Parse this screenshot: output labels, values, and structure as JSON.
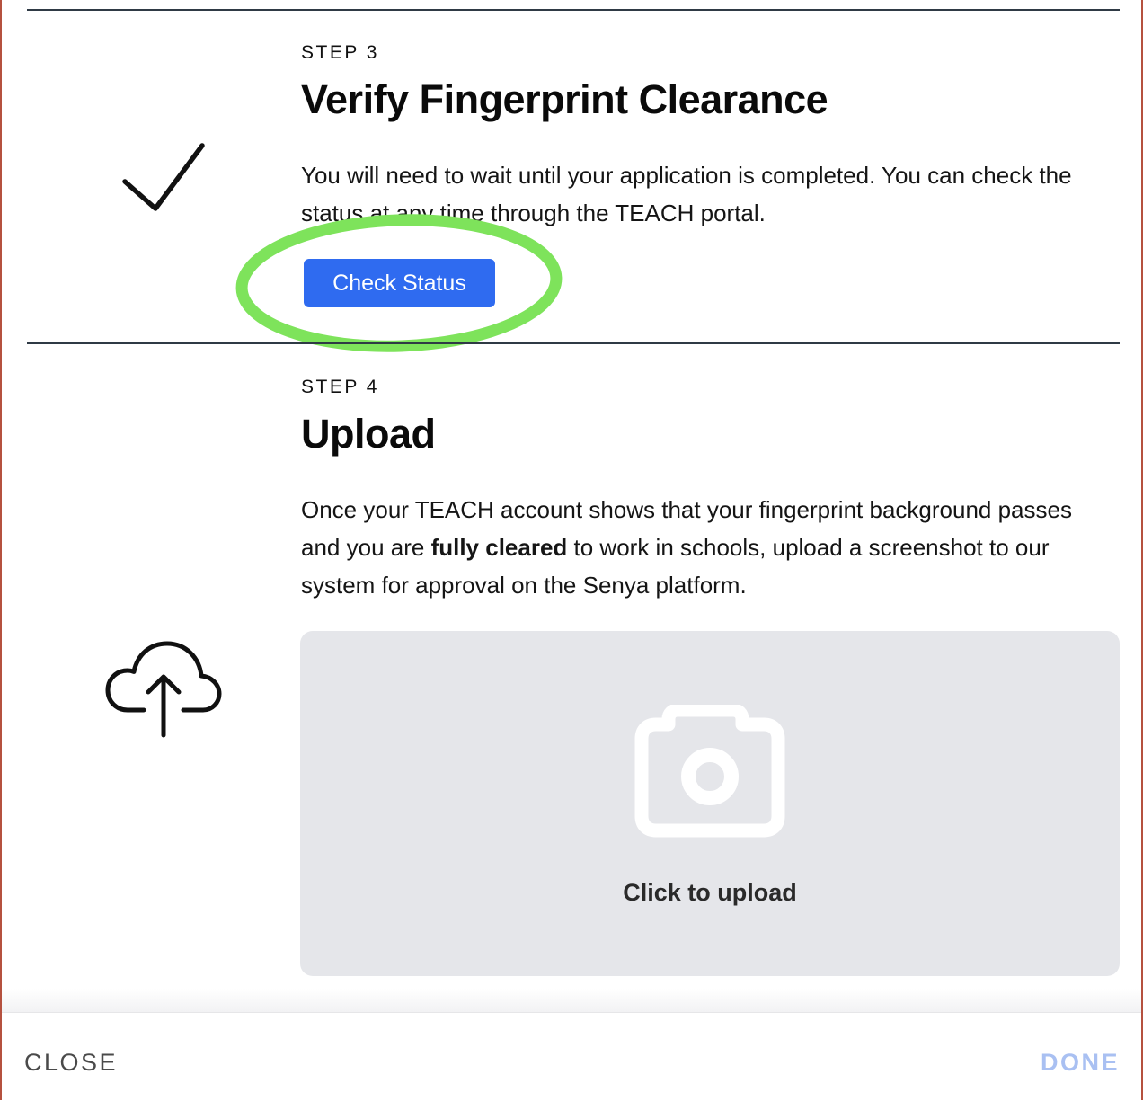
{
  "step3": {
    "eyebrow": "STEP 3",
    "title": "Verify Fingerprint Clearance",
    "description": "You will need to wait until your application is completed. You can check the status at any time through the TEACH portal.",
    "button_label": "Check Status",
    "icon": "checkmark-icon"
  },
  "step4": {
    "eyebrow": "STEP 4",
    "title": "Upload",
    "description_before": "Once your TEACH account shows that your fingerprint background passes and you are ",
    "description_bold": "fully cleared",
    "description_after": " to work in schools, upload a screenshot to our system for approval on the Senya platform.",
    "icon": "cloud-upload-icon",
    "upload": {
      "label": "Click to upload",
      "icon": "camera-icon"
    }
  },
  "annotation": {
    "highlight_color": "#7ee35b"
  },
  "footer": {
    "close_label": "CLOSE",
    "done_label": "DONE"
  },
  "colors": {
    "primary": "#2f6bf0",
    "done_disabled": "#a9c0f2",
    "upload_bg": "#e5e6ea"
  }
}
